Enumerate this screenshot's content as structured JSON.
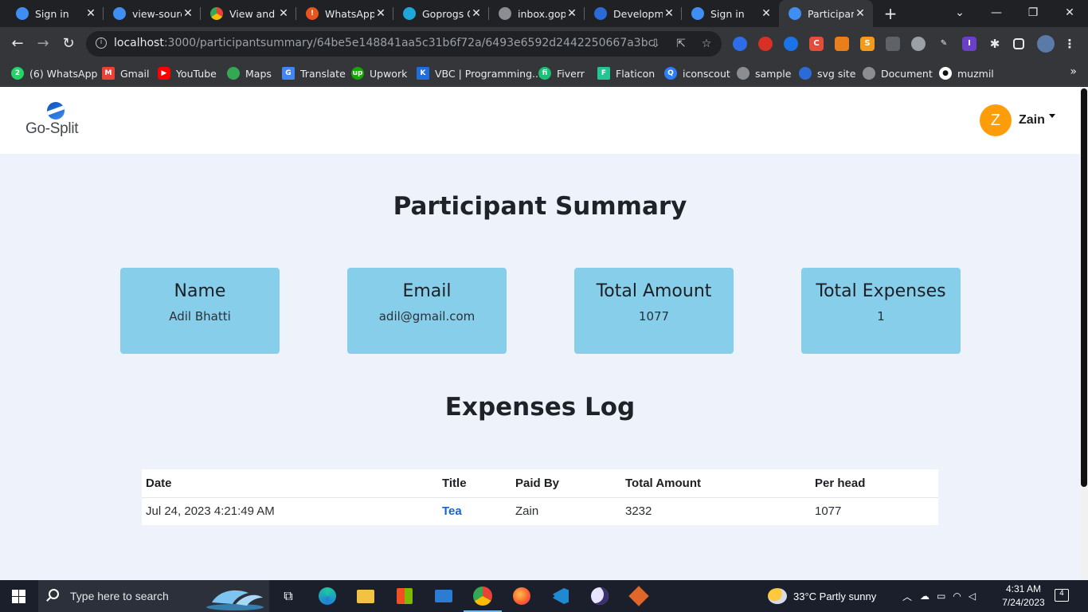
{
  "browser": {
    "tabs": [
      {
        "label": "Sign in",
        "icon": "go-split-favicon",
        "color": "#3f8ff2",
        "active": false
      },
      {
        "label": "view-source",
        "icon": "go-split-favicon",
        "color": "#3f8ff2",
        "active": false
      },
      {
        "label": "View and e",
        "icon": "chrome-favicon",
        "color": "#e0b020",
        "active": false
      },
      {
        "label": "WhatsApp",
        "icon": "whatsapp-favicon",
        "color": "#e8541e",
        "active": false
      },
      {
        "label": "Goprogs C",
        "icon": "goprogs-favicon",
        "color": "#1ea7d8",
        "active": false
      },
      {
        "label": "inbox.gopr",
        "icon": "globe-favicon",
        "color": "#8a8d91",
        "active": false
      },
      {
        "label": "Developme",
        "icon": "dev-favicon",
        "color": "#2b6bd8",
        "active": false
      },
      {
        "label": "Sign in",
        "icon": "go-split-favicon",
        "color": "#3f8ff2",
        "active": false
      },
      {
        "label": "Participant",
        "icon": "go-split-favicon",
        "color": "#3f8ff2",
        "active": true
      }
    ],
    "url_host": "localhost",
    "url_path": ":3000/participantsummary/64be5e148841aa5c31b6f72a/6493e6592d2442250667a3bc",
    "bookmarks": [
      {
        "label": "(6) WhatsApp",
        "icon": "whatsapp-icon",
        "color": "#25d366"
      },
      {
        "label": "Gmail",
        "icon": "gmail-icon",
        "color": "#ea4335"
      },
      {
        "label": "YouTube",
        "icon": "youtube-icon",
        "color": "#ff0000"
      },
      {
        "label": "Maps",
        "icon": "maps-icon",
        "color": "#34a853"
      },
      {
        "label": "Translate",
        "icon": "translate-icon",
        "color": "#4285f4"
      },
      {
        "label": "Upwork",
        "icon": "upwork-icon",
        "color": "#14a800"
      },
      {
        "label": "VBC | Programming...",
        "icon": "vbc-icon",
        "color": "#1e6fd9"
      },
      {
        "label": "Fiverr",
        "icon": "fiverr-icon",
        "color": "#1dbf73"
      },
      {
        "label": "Flaticon",
        "icon": "flaticon-icon",
        "color": "#23c690"
      },
      {
        "label": "iconscout",
        "icon": "iconscout-icon",
        "color": "#2d7ff9"
      },
      {
        "label": "sample",
        "icon": "globe-icon",
        "color": "#8a8d91"
      },
      {
        "label": "svg site",
        "icon": "svg-site-icon",
        "color": "#2b6bd8"
      },
      {
        "label": "Document",
        "icon": "globe-icon",
        "color": "#8a8d91"
      },
      {
        "label": "muzmil",
        "icon": "github-icon",
        "color": "#ffffff"
      }
    ]
  },
  "app": {
    "brand": "Go-Split",
    "user": {
      "initial": "Z",
      "name": "Zain",
      "avatar_color": "#ff9c0a"
    },
    "page_title": "Participant Summary",
    "cards": [
      {
        "label": "Name",
        "value": "Adil Bhatti"
      },
      {
        "label": "Email",
        "value": "adil@gmail.com"
      },
      {
        "label": "Total Amount",
        "value": "1077"
      },
      {
        "label": "Total Expenses",
        "value": "1"
      }
    ],
    "log_title": "Expenses Log",
    "table": {
      "headers": [
        "Date",
        "Title",
        "Paid By",
        "Total Amount",
        "Per head"
      ],
      "rows": [
        [
          "Jul 24, 2023 4:21:49 AM",
          "Tea",
          "Zain",
          "3232",
          "1077"
        ]
      ]
    },
    "accent_color": "#87ceeb"
  },
  "taskbar": {
    "search_placeholder": "Type here to search",
    "weather": "33°C  Partly sunny",
    "time": "4:31 AM",
    "date": "7/24/2023",
    "notification_count": "4"
  }
}
